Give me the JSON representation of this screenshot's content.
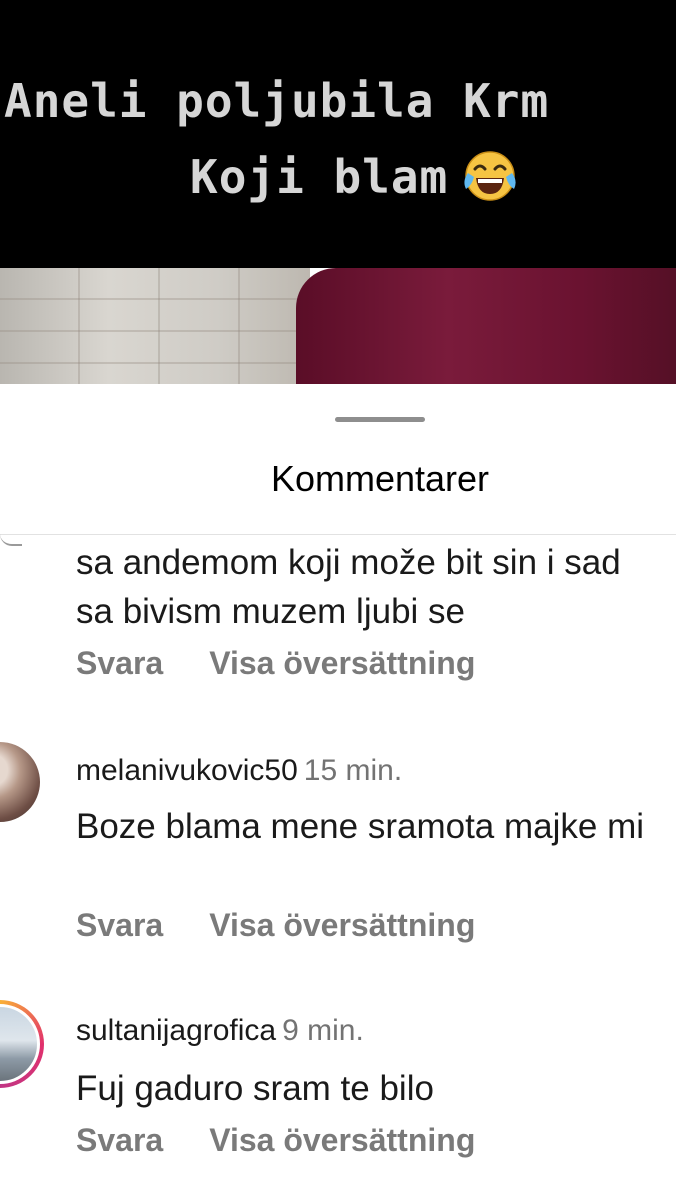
{
  "story": {
    "caption_line1": "Aneli  poljubila Krm",
    "caption_line2": "Koji blam",
    "caption_emoji": "face-with-tears-of-joy"
  },
  "sheet": {
    "title": "Kommentarer"
  },
  "comments": [
    {
      "username": "",
      "time": "",
      "text": "sa andemom koji može bit sin i sad sa bivism muzem ljubi se",
      "reply_label": "Svara",
      "translate_label": "Visa översättning"
    },
    {
      "username": "melanivukovic50",
      "time": "15 min.",
      "text": "Boze blama mene sramota majke mi",
      "reply_label": "Svara",
      "translate_label": "Visa översättning"
    },
    {
      "username": "sultanijagrofica",
      "time": "9 min.",
      "text": "Fuj gaduro sram te bilo",
      "reply_label": "Svara",
      "translate_label": "Visa översättning"
    }
  ],
  "colors": {
    "story_background": "#000000",
    "caption_text": "#d6d6d6",
    "secondary_text": "#737373",
    "action_text": "#7a7a7a",
    "story_ring_gradient": [
      "#f9b037",
      "#e1306c",
      "#c13584",
      "#f56040"
    ]
  }
}
